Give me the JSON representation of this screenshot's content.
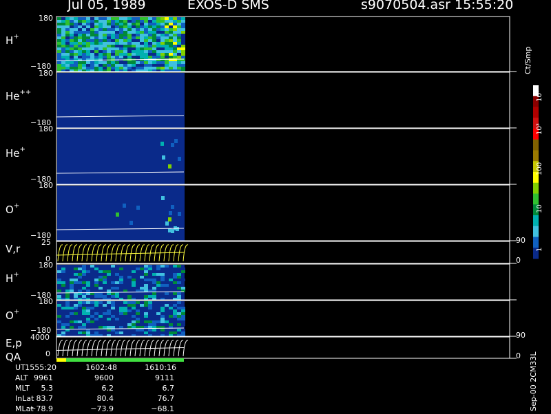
{
  "title": {
    "date": "Jul 05, 1989",
    "instrument": "EXOS-D SMS",
    "file": "s9070504.asr",
    "time": "15:55:20"
  },
  "panels": [
    {
      "id": "H+",
      "species": "H",
      "charge": "+",
      "ymax": "180",
      "ymin": "−180",
      "type": "spectrogram"
    },
    {
      "id": "He++",
      "species": "He",
      "charge": "++",
      "ymax": "180",
      "ymin": "−180",
      "type": "spectrogram"
    },
    {
      "id": "He+",
      "species": "He",
      "charge": "+",
      "ymax": "180",
      "ymin": "−180",
      "type": "spectrogram"
    },
    {
      "id": "O+",
      "species": "O",
      "charge": "+",
      "ymax": "180",
      "ymin": "−180",
      "type": "spectrogram"
    },
    {
      "id": "V,r",
      "species": "V,r",
      "charge": "",
      "ymax": "25",
      "ymin": "0",
      "right_top": "90",
      "right_bottom": "0",
      "type": "line"
    },
    {
      "id": "H+2",
      "species": "H",
      "charge": "+",
      "ymax": "180",
      "ymin": "−180",
      "type": "spectrogram"
    },
    {
      "id": "O+2",
      "species": "O",
      "charge": "+",
      "ymax": "180",
      "ymin": "−180",
      "type": "spectrogram"
    },
    {
      "id": "E,p",
      "species": "E,p",
      "charge": "",
      "ymax": "4000",
      "ymin": "0",
      "right_top": "90",
      "right_bottom": "0",
      "type": "line"
    }
  ],
  "qa_label": "QA",
  "colorbar": {
    "unit": "Ct/Smp",
    "ticks": [
      "10⁴",
      "10³",
      "100",
      "10",
      "1"
    ],
    "colors": [
      "#ffffff",
      "#8b0000",
      "#b00000",
      "#d01010",
      "#ff0000",
      "#806000",
      "#9a7a00",
      "#c8c800",
      "#ffff00",
      "#80d000",
      "#30c030",
      "#008a3a",
      "#00b0b0",
      "#40c0e0",
      "#1060c0",
      "#0a2a8a"
    ]
  },
  "ephemeris": {
    "rows": [
      {
        "label": "UT",
        "values": [
          "1555:20",
          "1602:48",
          "1610:16"
        ]
      },
      {
        "label": "ALT",
        "values": [
          "9961",
          "9600",
          "9111"
        ]
      },
      {
        "label": "MLT",
        "values": [
          "5.3",
          "6.2",
          "6.7"
        ]
      },
      {
        "label": "InLat",
        "values": [
          "83.7",
          "80.4",
          "76.7"
        ]
      },
      {
        "label": "MLat",
        "values": [
          "−78.9",
          "−73.9",
          "−68.1"
        ]
      }
    ]
  },
  "product_id": "Sep-00 2CM33L",
  "chart_data": {
    "type": "heatmap",
    "title": "Jul 05, 1989   EXOS-D SMS",
    "xlabel": "UT",
    "x": [
      "1555:20",
      "1602:48",
      "1610:16"
    ],
    "series": [
      {
        "name": "H+",
        "ylim": [
          -180,
          180
        ],
        "level": "high"
      },
      {
        "name": "He++",
        "ylim": [
          -180,
          180
        ],
        "level": "low"
      },
      {
        "name": "He+",
        "ylim": [
          -180,
          180
        ],
        "level": "low"
      },
      {
        "name": "O+",
        "ylim": [
          -180,
          180
        ],
        "level": "low"
      },
      {
        "name": "V,r",
        "ylim": [
          0,
          25
        ],
        "level": "line"
      },
      {
        "name": "H+",
        "ylim": [
          -180,
          180
        ],
        "level": "medium"
      },
      {
        "name": "O+",
        "ylim": [
          -180,
          180
        ],
        "level": "medium"
      },
      {
        "name": "E,p",
        "ylim": [
          0,
          4000
        ],
        "level": "line"
      }
    ],
    "colorbar_range": [
      1,
      10000
    ],
    "colorbar_scale": "log",
    "colorbar_label": "Ct/Smp",
    "data_coverage_fraction": 0.28
  }
}
